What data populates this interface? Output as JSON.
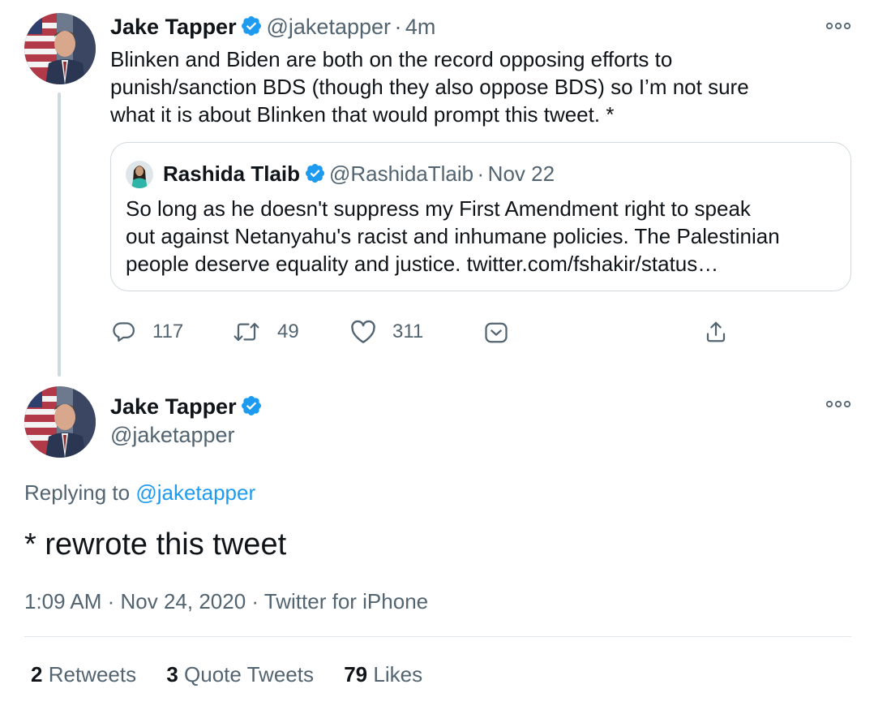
{
  "tweet1": {
    "name": "Jake Tapper",
    "handle": "@jaketapper",
    "separator": "·",
    "time": "4m",
    "text_lines": [
      "Blinken and Biden are both on the record opposing efforts to",
      "punish/sanction BDS (though they also oppose BDS) so I’m not sure",
      "what it is about Blinken that would prompt this tweet. *"
    ],
    "quote": {
      "name": "Rashida Tlaib",
      "handle": "@RashidaTlaib",
      "separator": "·",
      "date": "Nov 22",
      "text_lines": [
        "So long as he doesn't suppress my First Amendment right to speak",
        "out against Netanyahu's racist and inhumane policies. The Palestinian",
        "people deserve equality and justice. twitter.com/fshakir/status…"
      ]
    },
    "actions": {
      "replies": "117",
      "retweets": "49",
      "likes": "311"
    }
  },
  "tweet2": {
    "name": "Jake Tapper",
    "handle": "@jaketapper",
    "replying_prefix": "Replying to",
    "replying_handle": "@jaketapper",
    "text": "* rewrote this tweet",
    "meta": "1:09 AM · Nov 24, 2020 · Twitter for iPhone",
    "stats": {
      "retweets_count": "2",
      "retweets_label": "Retweets",
      "quote_count": "3",
      "quote_label": "Quote Tweets",
      "likes_count": "79",
      "likes_label": "Likes"
    }
  },
  "colors": {
    "verified": "#1d9bf0",
    "link": "#1d9bf0",
    "muted": "#536471",
    "text": "#0f1419",
    "border": "#cfd9de"
  },
  "icons": {
    "verified": "verified-badge-icon",
    "more": "more-horizontal-icon",
    "reply": "reply-icon",
    "retweet": "retweet-icon",
    "like": "heart-icon",
    "save": "bookmark-icon",
    "share": "share-icon"
  }
}
